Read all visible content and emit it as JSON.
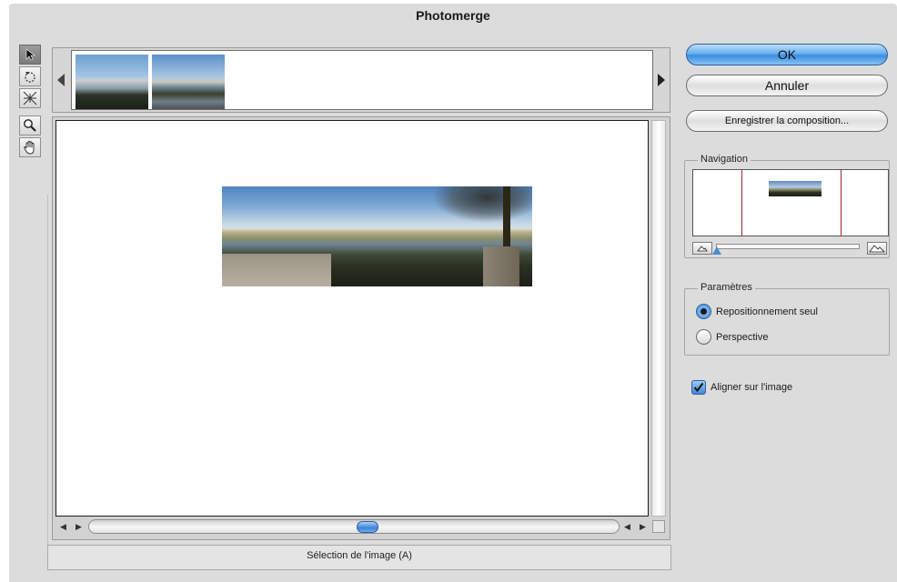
{
  "window": {
    "title": "Photomerge"
  },
  "tools": [
    {
      "name": "select-image-tool",
      "icon": "arrow-pointer-icon"
    },
    {
      "name": "rotate-image-tool",
      "icon": "rotate-icon"
    },
    {
      "name": "vanishing-point-tool",
      "icon": "vanishing-point-icon"
    },
    {
      "name": "zoom-tool",
      "icon": "magnifier-icon"
    },
    {
      "name": "hand-tool",
      "icon": "hand-icon"
    }
  ],
  "buttons": {
    "ok": "OK",
    "cancel": "Annuler",
    "save": "Enregistrer la composition..."
  },
  "navigation": {
    "label": "Navigation",
    "zoom_level": 0.03
  },
  "parameters": {
    "label": "Paramètres",
    "options": [
      "Repositionnement seul",
      "Perspective"
    ],
    "selected": "Repositionnement seul"
  },
  "align": {
    "label": "Aligner sur l'image",
    "checked": true
  },
  "status": "Sélection de l'image (A)",
  "colors": {
    "accent": "#3b8de0",
    "frame": "#b0222a"
  }
}
